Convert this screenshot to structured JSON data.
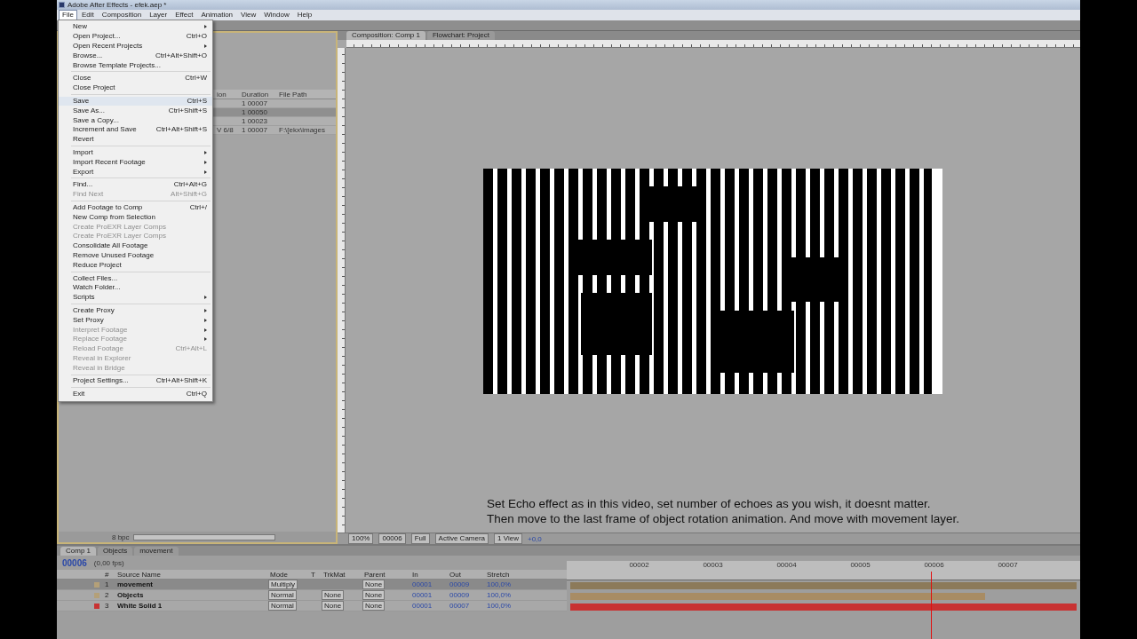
{
  "window": {
    "title": "Adobe After Effects - efek.aep *"
  },
  "menu_bar": [
    {
      "label": "File",
      "selected": true
    },
    {
      "label": "Edit",
      "selected": false
    },
    {
      "label": "Composition",
      "selected": false
    },
    {
      "label": "Layer",
      "selected": false
    },
    {
      "label": "Effect",
      "selected": false
    },
    {
      "label": "Animation",
      "selected": false
    },
    {
      "label": "View",
      "selected": false
    },
    {
      "label": "Window",
      "selected": false
    },
    {
      "label": "Help",
      "selected": false
    }
  ],
  "file_menu": [
    {
      "kind": "item",
      "label": "New",
      "submenu": true,
      "disabled": false,
      "highlighted": false
    },
    {
      "kind": "item",
      "label": "Open Project...",
      "shortcut": "Ctrl+O",
      "submenu": false,
      "disabled": false,
      "highlighted": false
    },
    {
      "kind": "item",
      "label": "Open Recent Projects",
      "submenu": true,
      "disabled": false,
      "highlighted": false
    },
    {
      "kind": "item",
      "label": "Browse...",
      "shortcut": "Ctrl+Alt+Shift+O",
      "submenu": false,
      "disabled": false,
      "highlighted": false
    },
    {
      "kind": "item",
      "label": "Browse Template Projects...",
      "submenu": false,
      "disabled": false,
      "highlighted": false
    },
    {
      "kind": "separator"
    },
    {
      "kind": "item",
      "label": "Close",
      "shortcut": "Ctrl+W",
      "submenu": false,
      "disabled": false,
      "highlighted": false
    },
    {
      "kind": "item",
      "label": "Close Project",
      "submenu": false,
      "disabled": false,
      "highlighted": false
    },
    {
      "kind": "separator"
    },
    {
      "kind": "item",
      "label": "Save",
      "shortcut": "Ctrl+S",
      "submenu": false,
      "disabled": false,
      "highlighted": true
    },
    {
      "kind": "item",
      "label": "Save As...",
      "shortcut": "Ctrl+Shift+S",
      "submenu": false,
      "disabled": false,
      "highlighted": false
    },
    {
      "kind": "item",
      "label": "Save a Copy...",
      "submenu": false,
      "disabled": false,
      "highlighted": false
    },
    {
      "kind": "item",
      "label": "Increment and Save",
      "shortcut": "Ctrl+Alt+Shift+S",
      "submenu": false,
      "disabled": false,
      "highlighted": false
    },
    {
      "kind": "item",
      "label": "Revert",
      "submenu": false,
      "disabled": false,
      "highlighted": false
    },
    {
      "kind": "separator"
    },
    {
      "kind": "item",
      "label": "Import",
      "submenu": true,
      "disabled": false,
      "highlighted": false
    },
    {
      "kind": "item",
      "label": "Import Recent Footage",
      "submenu": true,
      "disabled": false,
      "highlighted": false
    },
    {
      "kind": "item",
      "label": "Export",
      "submenu": true,
      "disabled": false,
      "highlighted": false
    },
    {
      "kind": "separator"
    },
    {
      "kind": "item",
      "label": "Find...",
      "shortcut": "Ctrl+Alt+G",
      "submenu": false,
      "disabled": false,
      "highlighted": false
    },
    {
      "kind": "item",
      "label": "Find Next",
      "shortcut": "Alt+Shift+G",
      "submenu": false,
      "disabled": true,
      "highlighted": false
    },
    {
      "kind": "separator"
    },
    {
      "kind": "item",
      "label": "Add Footage to Comp",
      "shortcut": "Ctrl+/",
      "submenu": false,
      "disabled": false,
      "highlighted": false
    },
    {
      "kind": "item",
      "label": "New Comp from Selection",
      "submenu": false,
      "disabled": false,
      "highlighted": false
    },
    {
      "kind": "item",
      "label": "Create ProEXR Layer Comps",
      "submenu": false,
      "disabled": true,
      "highlighted": false
    },
    {
      "kind": "item",
      "label": "Create ProEXR Layer Comps",
      "submenu": false,
      "disabled": true,
      "highlighted": false
    },
    {
      "kind": "item",
      "label": "Consolidate All Footage",
      "submenu": false,
      "disabled": false,
      "highlighted": false
    },
    {
      "kind": "item",
      "label": "Remove Unused Footage",
      "submenu": false,
      "disabled": false,
      "highlighted": false
    },
    {
      "kind": "item",
      "label": "Reduce Project",
      "submenu": false,
      "disabled": false,
      "highlighted": false
    },
    {
      "kind": "separator"
    },
    {
      "kind": "item",
      "label": "Collect Files...",
      "submenu": false,
      "disabled": false,
      "highlighted": false
    },
    {
      "kind": "item",
      "label": "Watch Folder...",
      "submenu": false,
      "disabled": false,
      "highlighted": false
    },
    {
      "kind": "item",
      "label": "Scripts",
      "submenu": true,
      "disabled": false,
      "highlighted": false
    },
    {
      "kind": "separator"
    },
    {
      "kind": "item",
      "label": "Create Proxy",
      "submenu": true,
      "disabled": false,
      "highlighted": false
    },
    {
      "kind": "item",
      "label": "Set Proxy",
      "submenu": true,
      "disabled": false,
      "highlighted": false
    },
    {
      "kind": "item",
      "label": "Interpret Footage",
      "submenu": true,
      "disabled": true,
      "highlighted": false
    },
    {
      "kind": "item",
      "label": "Replace Footage",
      "submenu": true,
      "disabled": true,
      "highlighted": false
    },
    {
      "kind": "item",
      "label": "Reload Footage",
      "shortcut": "Ctrl+Alt+L",
      "submenu": false,
      "disabled": true,
      "highlighted": false
    },
    {
      "kind": "item",
      "label": "Reveal in Explorer",
      "submenu": false,
      "disabled": true,
      "highlighted": false
    },
    {
      "kind": "item",
      "label": "Reveal in Bridge",
      "submenu": false,
      "disabled": true,
      "highlighted": false
    },
    {
      "kind": "separator"
    },
    {
      "kind": "item",
      "label": "Project Settings...",
      "shortcut": "Ctrl+Alt+Shift+K",
      "submenu": false,
      "disabled": false,
      "highlighted": false
    },
    {
      "kind": "separator"
    },
    {
      "kind": "item",
      "label": "Exit",
      "shortcut": "Ctrl+Q",
      "submenu": false,
      "disabled": false,
      "highlighted": false
    }
  ],
  "project_panel": {
    "columns": [
      "ion",
      "Duration",
      "File Path"
    ],
    "rows": [
      {
        "duration": "1 00007",
        "selected": false
      },
      {
        "duration": "1 00050",
        "selected": true
      },
      {
        "duration": "1 00023",
        "selected": false
      },
      {
        "column_1": "V 6/8",
        "duration": "1 00007",
        "file_path": "F:\\[ekx\\images",
        "selected": false
      }
    ],
    "bit_depth": "8 bpc"
  },
  "viewer": {
    "tabs": [
      {
        "label": "Composition: Comp 1",
        "selected": true
      },
      {
        "label": "Flowchart: Project",
        "selected": false
      }
    ],
    "caption": [
      "Set Echo effect as in this video, set number of echoes as you wish, it doesnt matter.",
      "Then move to the last frame of object rotation animation. And move with movement layer."
    ],
    "toolbar": {
      "zoom": "100%",
      "timecode": "00006",
      "resolution": "Full",
      "camera": "Active Camera",
      "views": "1 View",
      "exposure": "+0,0"
    }
  },
  "timeline": {
    "tabs": [
      {
        "label": "Comp 1",
        "selected": true
      },
      {
        "label": "Objects",
        "selected": false
      },
      {
        "label": "movement",
        "selected": false
      }
    ],
    "timecode": "00006",
    "fps": "(0,00 fps)",
    "columns": [
      "#",
      "Source Name",
      "Mode",
      "T",
      "TrkMat",
      "Parent",
      "In",
      "Out",
      "Stretch"
    ],
    "layers": [
      {
        "number": "1",
        "name": "movement",
        "mode": "Multiply",
        "parent": "None",
        "in": "00001",
        "out": "00009",
        "stretch": "100,0%",
        "selected": true,
        "color": "#b4a078",
        "level": 1.0
      },
      {
        "number": "2",
        "name": "Objects",
        "mode": "Normal",
        "trkmat": "None",
        "parent": "None",
        "in": "00001",
        "out": "00009",
        "stretch": "100,0%",
        "selected": false,
        "color": "#b4a078",
        "level": 0.82
      },
      {
        "number": "3",
        "name": "White Solid 1",
        "mode": "Normal",
        "trkmat": "None",
        "parent": "None",
        "in": "00001",
        "out": "00007",
        "stretch": "100,0%",
        "selected": false,
        "color": "#c83232",
        "level": 1.0
      }
    ],
    "ruler_labels": [
      "00002",
      "00003",
      "00004",
      "00005",
      "00006",
      "00007"
    ],
    "playhead": {
      "level": 0.71
    }
  }
}
